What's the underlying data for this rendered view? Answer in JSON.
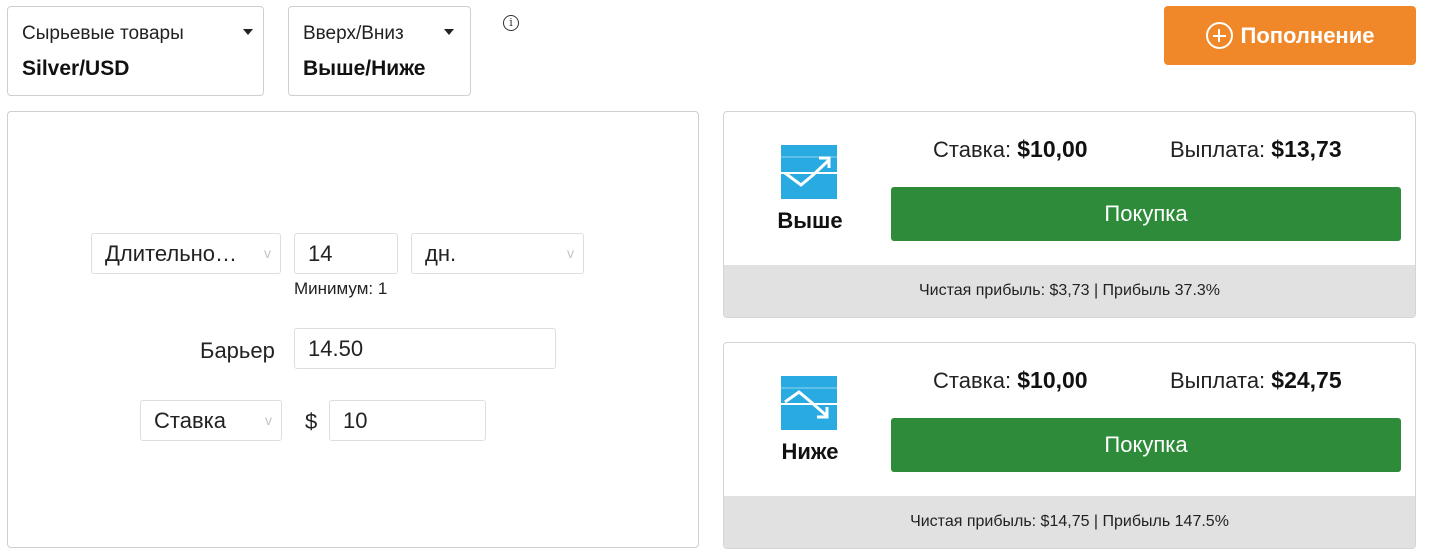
{
  "asset_selector": {
    "label": "Сырьевые товары",
    "value": "Silver/USD"
  },
  "type_selector": {
    "label": "Вверх/Вниз",
    "value": "Выше/Ниже"
  },
  "info_glyph": "i",
  "deposit_button": {
    "label": "Пополнение"
  },
  "trade_form": {
    "duration_select": "Длительно…",
    "duration_value": "14",
    "duration_unit": "дн.",
    "minimum_note": "Минимум: 1",
    "barrier_label": "Барьер",
    "barrier_value": "14.50",
    "stake_select": "Ставка",
    "currency_symbol": "$",
    "stake_value": "10",
    "chevron_glyph": "v"
  },
  "contracts": [
    {
      "direction": "Выше",
      "icon": "trend-up-icon",
      "stake_label": "Ставка:",
      "stake_value": "$10,00",
      "payout_label": "Выплата:",
      "payout_value": "$13,73",
      "buy_label": "Покупка",
      "profit_text": "Чистая прибыль: $3,73 | Прибыль 37.3%"
    },
    {
      "direction": "Ниже",
      "icon": "trend-down-icon",
      "stake_label": "Ставка:",
      "stake_value": "$10,00",
      "payout_label": "Выплата:",
      "payout_value": "$24,75",
      "buy_label": "Покупка",
      "profit_text": "Чистая прибыль: $14,75 | Прибыль 147.5%"
    }
  ],
  "colors": {
    "deposit_orange": "#f0882a",
    "buy_green": "#2e8b3a",
    "icon_blue": "#29abe2",
    "profit_bar_gray": "#e1e1e1"
  }
}
